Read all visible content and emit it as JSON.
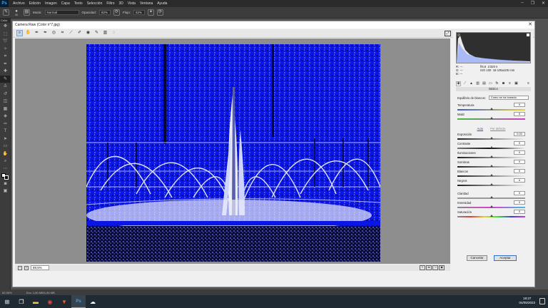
{
  "app": {
    "logo": "Ps",
    "menu": [
      "Archivo",
      "Edición",
      "Imagen",
      "Capa",
      "Texto",
      "Selección",
      "Filtro",
      "3D",
      "Vista",
      "Ventana",
      "Ayuda"
    ]
  },
  "options": {
    "brush_size": "40",
    "mode_label": "Modo:",
    "mode_value": "Normal",
    "opacity_label": "Opacidad:",
    "opacity_value": "82%",
    "flow_label": "Flujo:",
    "flow_value": "52%"
  },
  "toolbar": {
    "tab_label": "Color"
  },
  "status": {
    "zoom": "82,96%",
    "doc": "Doc: 1,80 MB/1,80 MB"
  },
  "taskbar": {
    "time": "19:27",
    "date": "04/05/2023"
  },
  "dialog": {
    "title": "Camera Raw (Color n°7.jpg)",
    "zoom": "89,5%",
    "cancel_label": "Cancelar",
    "ok_label": "Aceptar"
  },
  "panel": {
    "readout": {
      "r_label": "R:",
      "g_label": "G:",
      "b_label": "B:",
      "r_value": "---",
      "g_value": "---",
      "b_value": "---",
      "aperture": "f/5,6",
      "shutter": "1/320 s",
      "iso": "ISO 100",
      "lens": "18-105a105 mm"
    },
    "section_title": "Básico",
    "wb_label": "Equilibrio de blancos:",
    "wb_value": "Como se ha tomado",
    "auto_label": "Auto",
    "default_label": "Por defecto",
    "sliders": [
      {
        "label": "Temperatura",
        "value": "0",
        "pos": 0.5
      },
      {
        "label": "Matiz",
        "value": "0",
        "pos": 0.5
      },
      {
        "label": "Exposición",
        "value": "0,00",
        "pos": 0.5
      },
      {
        "label": "Contraste",
        "value": "0",
        "pos": 0.5
      },
      {
        "label": "Iluminaciones",
        "value": "0",
        "pos": 0.5
      },
      {
        "label": "Sombras",
        "value": "0",
        "pos": 0.5
      },
      {
        "label": "Blancos",
        "value": "0",
        "pos": 0.5
      },
      {
        "label": "Negros",
        "value": "0",
        "pos": 0.5
      },
      {
        "label": "Claridad",
        "value": "0",
        "pos": 0.5
      },
      {
        "label": "Intensidad",
        "value": "0",
        "pos": 0.5
      },
      {
        "label": "Saturación",
        "value": "0",
        "pos": 0.5
      }
    ]
  }
}
